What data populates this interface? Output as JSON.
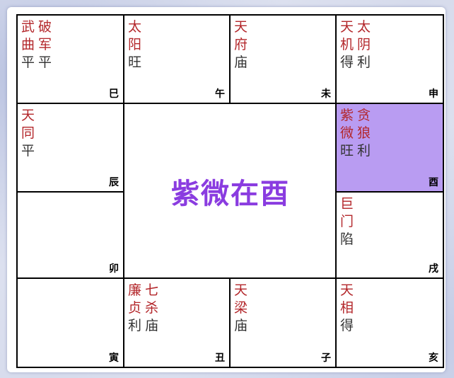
{
  "center_title": "紫微在酉",
  "colors": {
    "star_name": "#b3262a",
    "status": "#333333",
    "highlight": "#b99cf2",
    "center_title": "#8a3ce0"
  },
  "palaces": [
    {
      "id": "si",
      "branch": "巳",
      "stars": [
        {
          "chars": [
            "武",
            "曲"
          ],
          "status": "平"
        },
        {
          "chars": [
            "破",
            "军"
          ],
          "status": "平"
        }
      ]
    },
    {
      "id": "wu",
      "branch": "午",
      "stars": [
        {
          "chars": [
            "太",
            "阳"
          ],
          "status": "旺"
        }
      ]
    },
    {
      "id": "wei",
      "branch": "未",
      "stars": [
        {
          "chars": [
            "天",
            "府"
          ],
          "status": "庙"
        }
      ]
    },
    {
      "id": "shen",
      "branch": "申",
      "stars": [
        {
          "chars": [
            "天",
            "机"
          ],
          "status": "得"
        },
        {
          "chars": [
            "太",
            "阴"
          ],
          "status": "利"
        }
      ]
    },
    {
      "id": "chen",
      "branch": "辰",
      "stars": [
        {
          "chars": [
            "天",
            "同"
          ],
          "status": "平"
        }
      ]
    },
    {
      "id": "you",
      "branch": "酉",
      "highlight": true,
      "stars": [
        {
          "chars": [
            "紫",
            "微"
          ],
          "status": "旺"
        },
        {
          "chars": [
            "贪",
            "狼"
          ],
          "status": "利"
        }
      ]
    },
    {
      "id": "mao",
      "branch": "卯",
      "stars": []
    },
    {
      "id": "xu",
      "branch": "戌",
      "stars": [
        {
          "chars": [
            "巨",
            "门"
          ],
          "status": "陷"
        }
      ]
    },
    {
      "id": "yin",
      "branch": "寅",
      "stars": []
    },
    {
      "id": "chou",
      "branch": "丑",
      "stars": [
        {
          "chars": [
            "廉",
            "贞"
          ],
          "status": "利"
        },
        {
          "chars": [
            "七",
            "杀"
          ],
          "status": "庙"
        }
      ]
    },
    {
      "id": "zi",
      "branch": "子",
      "stars": [
        {
          "chars": [
            "天",
            "梁"
          ],
          "status": "庙"
        }
      ]
    },
    {
      "id": "hai",
      "branch": "亥",
      "stars": [
        {
          "chars": [
            "天",
            "相"
          ],
          "status": "得"
        }
      ]
    }
  ]
}
